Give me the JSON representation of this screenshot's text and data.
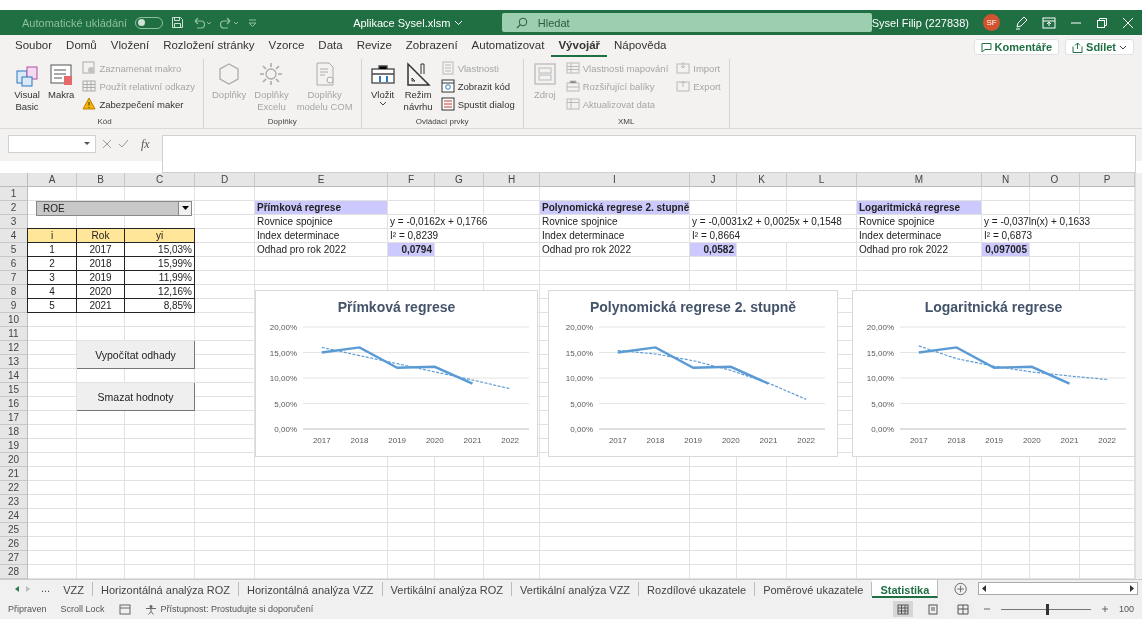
{
  "title_bar": {
    "autosave_label": "Automatické ukládání",
    "autosave_on": false,
    "file_title": "Aplikace Sysel.xlsm",
    "search_placeholder": "Hledat",
    "user_name": "Sysel Filip (227838)",
    "avatar_initials": "SF"
  },
  "menu_tabs": [
    {
      "label": "Soubor",
      "selected": false
    },
    {
      "label": "Domů",
      "selected": false
    },
    {
      "label": "Vložení",
      "selected": false
    },
    {
      "label": "Rozložení stránky",
      "selected": false
    },
    {
      "label": "Vzorce",
      "selected": false
    },
    {
      "label": "Data",
      "selected": false
    },
    {
      "label": "Revize",
      "selected": false
    },
    {
      "label": "Zobrazení",
      "selected": false
    },
    {
      "label": "Automatizovat",
      "selected": false
    },
    {
      "label": "Vývojář",
      "selected": true
    },
    {
      "label": "Nápověda",
      "selected": false
    }
  ],
  "header_buttons": [
    "Komentáře",
    "Sdílet"
  ],
  "ribbon_groups": [
    {
      "label": "Kód",
      "items": [
        {
          "label": "Visual\nBasic",
          "kind": "large",
          "disabled": false
        },
        {
          "label": "Makra",
          "kind": "large",
          "disabled": false
        },
        {
          "label": "Zaznamenat makro",
          "kind": "small",
          "disabled": true
        },
        {
          "label": "Použít relativní odkazy",
          "kind": "small",
          "disabled": true
        },
        {
          "label": "Zabezpečení maker",
          "kind": "small",
          "disabled": false
        }
      ]
    },
    {
      "label": "Doplňky",
      "items": [
        {
          "label": "Doplňky",
          "kind": "large",
          "disabled": true
        },
        {
          "label": "Doplňky\nExcelu",
          "kind": "large",
          "disabled": true
        },
        {
          "label": "Doplňky\nmodelu COM",
          "kind": "large",
          "disabled": true
        }
      ]
    },
    {
      "label": "Ovládací prvky",
      "items": [
        {
          "label": "Vložit",
          "kind": "menu",
          "disabled": false
        },
        {
          "label": "Režim\nnávrhu",
          "kind": "large",
          "disabled": false
        },
        {
          "label": "Vlastnosti",
          "kind": "small",
          "disabled": true
        },
        {
          "label": "Zobrazit kód",
          "kind": "small",
          "disabled": false
        },
        {
          "label": "Spustit dialog",
          "kind": "small",
          "disabled": false
        }
      ]
    },
    {
      "label": "XML",
      "items": [
        {
          "label": "Zdroj",
          "kind": "large",
          "disabled": true
        },
        {
          "label": "Vlastnosti mapování",
          "kind": "small",
          "disabled": true
        },
        {
          "label": "Rozšiřující balíky",
          "kind": "small",
          "disabled": true
        },
        {
          "label": "Aktualizovat data",
          "kind": "small",
          "disabled": true
        },
        {
          "label": "Import",
          "kind": "small",
          "disabled": true
        },
        {
          "label": "Export",
          "kind": "small",
          "disabled": true
        }
      ]
    }
  ],
  "formula_bar": {
    "function_label": "fx"
  },
  "sheet": {
    "columns": [
      "A",
      "B",
      "C",
      "D",
      "E",
      "F",
      "G",
      "H",
      "I",
      "J",
      "K",
      "L",
      "M",
      "N",
      "O",
      "P"
    ],
    "rows": [
      "1",
      "2",
      "3",
      "4",
      "5",
      "6",
      "7",
      "8",
      "9",
      "10",
      "11",
      "12",
      "13",
      "14",
      "15",
      "16",
      "17",
      "18",
      "19",
      "20",
      "21",
      "22",
      "23",
      "24",
      "25",
      "26",
      "27",
      "28"
    ],
    "dropdown": {
      "value": "ROE"
    },
    "data_table": {
      "columns": [
        "i",
        "Rok",
        "yi"
      ],
      "rows": [
        [
          "1",
          "2017",
          "15,03%"
        ],
        [
          "2",
          "2018",
          "15,99%"
        ],
        [
          "3",
          "2019",
          "11,99%"
        ],
        [
          "4",
          "2020",
          "12,16%"
        ],
        [
          "5",
          "2021",
          "8,85%"
        ]
      ]
    },
    "regression_blocks": [
      {
        "title": "Přímková regrese",
        "rows": [
          {
            "label": "Rovnice spojnice",
            "value": "y = -0,0162x + 0,1766",
            "highlighted": false
          },
          {
            "label": "Index determinace",
            "value": "I² = 0,8239",
            "highlighted": false
          },
          {
            "label": "Odhad pro rok 2022",
            "value": "0,0794",
            "highlighted": true
          }
        ]
      },
      {
        "title": "Polynomická regrese 2. stupně",
        "rows": [
          {
            "label": "Rovnice spojnice",
            "value": "y = -0,0031x2 + 0,0025x + 0,1548",
            "highlighted": false
          },
          {
            "label": "Index determinace",
            "value": "I² = 0,8664",
            "highlighted": false
          },
          {
            "label": "Odhad pro rok 2022",
            "value": "0,0582",
            "highlighted": true
          }
        ]
      },
      {
        "title": "Logaritmická regrese",
        "rows": [
          {
            "label": "Rovnice spojnice",
            "value": "y = -0,037ln(x) + 0,1633",
            "highlighted": false
          },
          {
            "label": "Index determinace",
            "value": "I² = 0,6873",
            "highlighted": false
          },
          {
            "label": "Odhad pro rok 2022",
            "value": "0,097005",
            "highlighted": true
          }
        ]
      }
    ],
    "buttons": [
      "Vypočítat odhady",
      "Smazat hodnoty"
    ]
  },
  "charts": [
    {
      "chart_data": {
        "type": "line",
        "title": "Přímková regrese",
        "categories": [
          "2017",
          "2018",
          "2019",
          "2020",
          "2021",
          "2022"
        ],
        "ylim": [
          0,
          20
        ],
        "grid": true,
        "yticks": [
          {
            "value": 0,
            "label": "0,00%"
          },
          {
            "value": 5,
            "label": "5,00%"
          },
          {
            "value": 10,
            "label": "10,00%"
          },
          {
            "value": 15,
            "label": "15,00%"
          },
          {
            "value": 20,
            "label": "20,00%"
          }
        ],
        "series": [
          {
            "color": "#5b9bd5",
            "values": [
              15.0,
              16.0,
              12.0,
              12.2,
              8.9,
              null
            ]
          },
          {
            "color": "#5b9bd5",
            "line_style": "dashed",
            "values": [
              16.0,
              14.4,
              12.8,
              11.2,
              9.6,
              7.9
            ]
          }
        ]
      }
    },
    {
      "chart_data": {
        "type": "line",
        "title": "Polynomická regrese 2. stupně",
        "categories": [
          "2017",
          "2018",
          "2019",
          "2020",
          "2021",
          "2022"
        ],
        "ylim": [
          0,
          20
        ],
        "grid": true,
        "yticks": [
          {
            "value": 0,
            "label": "0,00%"
          },
          {
            "value": 5,
            "label": "5,00%"
          },
          {
            "value": 10,
            "label": "10,00%"
          },
          {
            "value": 15,
            "label": "15,00%"
          },
          {
            "value": 20,
            "label": "20,00%"
          }
        ],
        "series": [
          {
            "color": "#5b9bd5",
            "values": [
              15.0,
              16.0,
              12.0,
              12.2,
              8.9,
              null
            ]
          },
          {
            "color": "#5b9bd5",
            "line_style": "dashed",
            "values": [
              15.4,
              14.7,
              13.4,
              11.5,
              9.0,
              5.8
            ]
          }
        ]
      }
    },
    {
      "chart_data": {
        "type": "line",
        "title": "Logaritnická regrese",
        "categories": [
          "2017",
          "2018",
          "2019",
          "2020",
          "2021",
          "2022"
        ],
        "ylim": [
          0,
          20
        ],
        "grid": true,
        "yticks": [
          {
            "value": 0,
            "label": "0,00%"
          },
          {
            "value": 5,
            "label": "5,00%"
          },
          {
            "value": 10,
            "label": "10,00%"
          },
          {
            "value": 15,
            "label": "15,00%"
          },
          {
            "value": 20,
            "label": "20,00%"
          }
        ],
        "series": [
          {
            "color": "#5b9bd5",
            "values": [
              15.0,
              16.0,
              12.0,
              12.2,
              8.9,
              null
            ]
          },
          {
            "color": "#5b9bd5",
            "line_style": "dashed",
            "values": [
              16.3,
              13.8,
              12.3,
              11.2,
              10.4,
              9.7
            ]
          }
        ]
      }
    }
  ],
  "sheet_tabs": {
    "overflow_label": "...",
    "tabs": [
      {
        "label": "VZZ",
        "selected": false
      },
      {
        "label": "Horizontálná analýza ROZ",
        "selected": false
      },
      {
        "label": "Horizontálná analýza VZZ",
        "selected": false
      },
      {
        "label": "Vertikální analýza ROZ",
        "selected": false
      },
      {
        "label": "Vertikální analýza VZZ",
        "selected": false
      },
      {
        "label": "Rozdílové ukazatele",
        "selected": false
      },
      {
        "label": "Poměrové ukazatele",
        "selected": false
      },
      {
        "label": "Statistika",
        "selected": true
      }
    ]
  },
  "status_bar": {
    "ready": "Připraven",
    "scroll_lock": "Scroll Lock",
    "accessibility": "Přístupnost: Prostudujte si doporučení",
    "views": [
      {
        "selected": true
      },
      {
        "selected": false
      },
      {
        "selected": false
      }
    ],
    "zoom": {
      "level": 0.5,
      "label": "100"
    }
  }
}
